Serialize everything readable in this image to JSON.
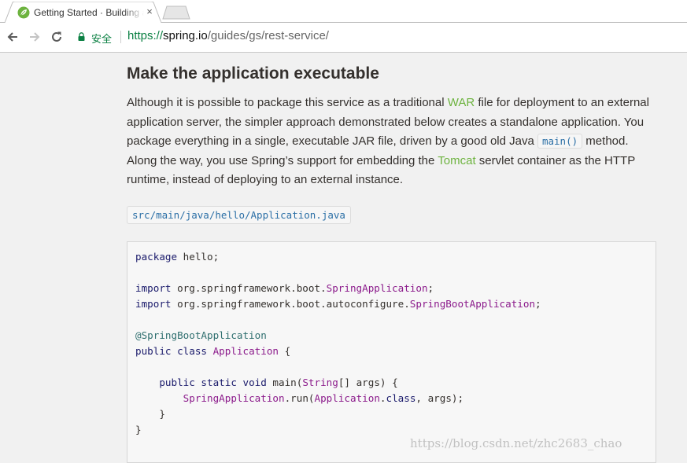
{
  "browser": {
    "tab": {
      "title": "Getting Started · Building a RESTful Web Service",
      "close_glyph": "×"
    },
    "toolbar": {
      "secure_label": "安全",
      "url_scheme": "https://",
      "url_host": "spring.io",
      "url_path": "/guides/gs/rest-service/"
    }
  },
  "article": {
    "heading": "Make the application executable",
    "para": {
      "t1": "Although it is possible to package this service as a traditional ",
      "war_link": "WAR",
      "t2": " file for deployment to an external application server, the simpler approach demonstrated below creates a standalone application. You package everything in a single, executable JAR file, driven by a good old Java ",
      "main_code": "main()",
      "t3": " method. Along the way, you use Spring’s support for embedding the ",
      "tomcat_link": "Tomcat",
      "t4": " servlet container as the HTTP runtime, instead of deploying to an external instance."
    },
    "filename": "src/main/java/hello/Application.java",
    "code": {
      "l1_kw": "package",
      "l1_rest": " hello;",
      "l2_kw": "import",
      "l2_pkg": " org.springframework.boot.",
      "l2_cls": "SpringApplication",
      "l2_end": ";",
      "l3_kw": "import",
      "l3_pkg": " org.springframework.boot.autoconfigure.",
      "l3_cls": "SpringBootApplication",
      "l3_end": ";",
      "l4_ann": "@SpringBootApplication",
      "l5_kw": "public class",
      "l5_cls": " Application",
      "l5_end": " {",
      "l6_indent": "    ",
      "l6_kw": "public static void",
      "l6_name": " main(",
      "l6_type": "String",
      "l6_end": "[] args) {",
      "l7_indent": "        ",
      "l7_cls": "SpringApplication",
      "l7_mid": ".run(",
      "l7_cls2": "Application",
      "l7_dot": ".",
      "l7_kw": "class",
      "l7_end": ", args);",
      "l8": "    }",
      "l9": "}"
    }
  },
  "watermark": "https://blog.csdn.net/zhc2683_chao",
  "colors": {
    "link_green": "#6db33f",
    "secure_green": "#0b8043",
    "code_blue": "#2b6fa6"
  },
  "icons": [
    "spring-leaf-icon",
    "close-icon",
    "back-arrow-icon",
    "forward-arrow-icon",
    "reload-icon",
    "lock-icon"
  ]
}
